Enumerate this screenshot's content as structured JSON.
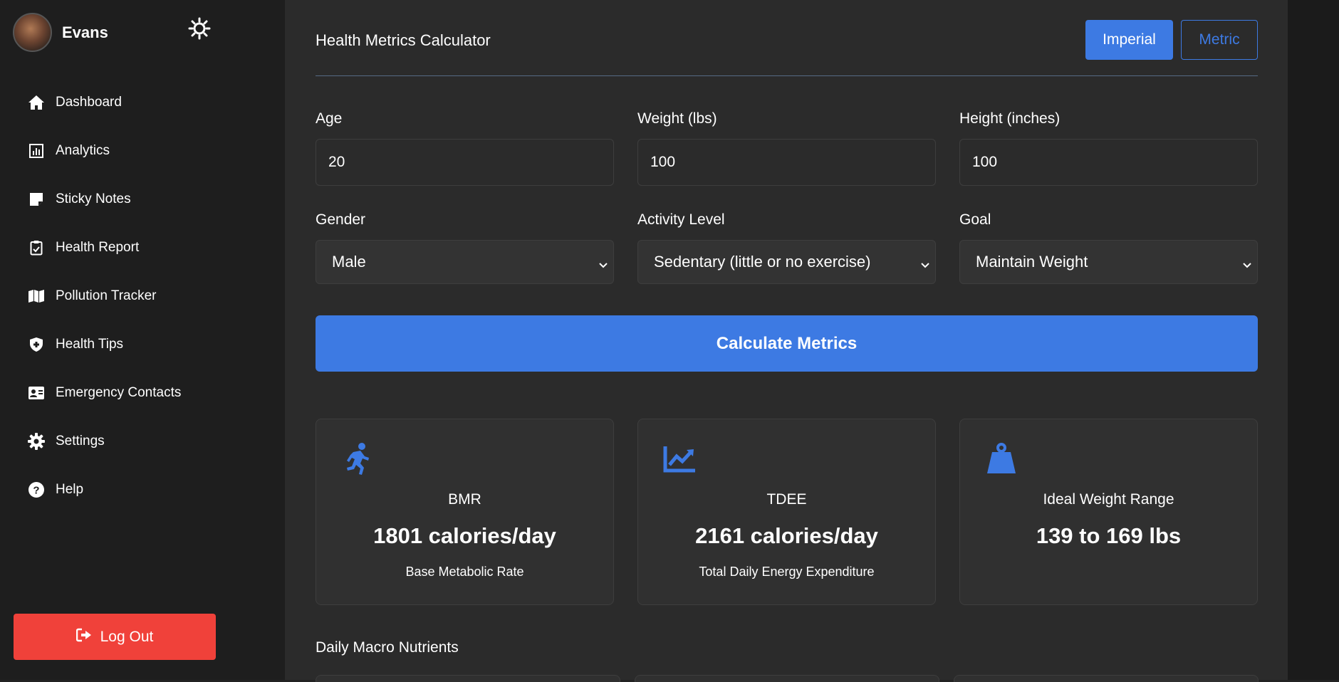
{
  "user": {
    "name": "Evans"
  },
  "sidebar": {
    "items": [
      {
        "label": "Dashboard",
        "icon": "home-icon"
      },
      {
        "label": "Analytics",
        "icon": "chart-icon"
      },
      {
        "label": "Sticky Notes",
        "icon": "sticky-note-icon"
      },
      {
        "label": "Health Report",
        "icon": "clipboard-icon"
      },
      {
        "label": "Pollution Tracker",
        "icon": "map-icon"
      },
      {
        "label": "Health Tips",
        "icon": "shield-icon"
      },
      {
        "label": "Emergency Contacts",
        "icon": "contact-card-icon"
      },
      {
        "label": "Settings",
        "icon": "gear-icon"
      },
      {
        "label": "Help",
        "icon": "help-circle-icon"
      }
    ],
    "logout_label": "Log Out"
  },
  "header": {
    "title": "Health Metrics Calculator",
    "units": {
      "imperial": "Imperial",
      "metric": "Metric",
      "selected": "Imperial"
    }
  },
  "form": {
    "age": {
      "label": "Age",
      "value": "20"
    },
    "weight": {
      "label": "Weight (lbs)",
      "value": "100"
    },
    "height": {
      "label": "Height (inches)",
      "value": "100"
    },
    "gender": {
      "label": "Gender",
      "value": "Male"
    },
    "activity": {
      "label": "Activity Level",
      "value": "Sedentary (little or no exercise)"
    },
    "goal": {
      "label": "Goal",
      "value": "Maintain Weight"
    },
    "submit_label": "Calculate Metrics"
  },
  "results": {
    "bmr": {
      "title": "BMR",
      "value": "1801 calories/day",
      "subtitle": "Base Metabolic Rate",
      "icon": "running-icon"
    },
    "tdee": {
      "title": "TDEE",
      "value": "2161 calories/day",
      "subtitle": "Total Daily Energy Expenditure",
      "icon": "trend-chart-icon"
    },
    "ideal": {
      "title": "Ideal Weight Range",
      "value": "139 to 169 lbs",
      "icon": "weight-icon"
    }
  },
  "macros": {
    "title": "Daily Macro Nutrients"
  },
  "colors": {
    "accent": "#3d7ae3",
    "danger": "#f0413a",
    "bg_sidebar": "#1e1e1e",
    "bg_main": "#2b2b2b"
  }
}
